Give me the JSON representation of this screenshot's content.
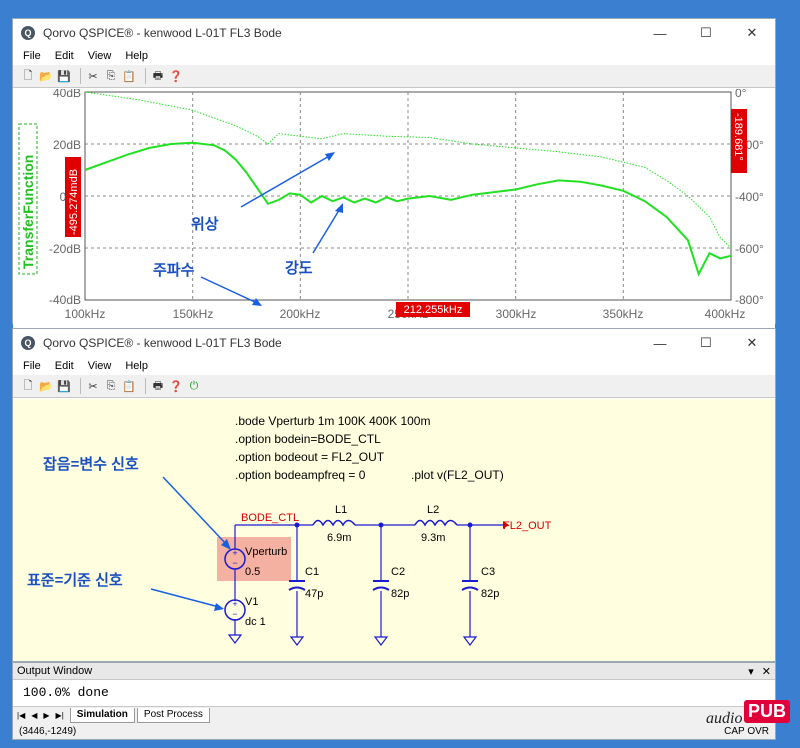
{
  "window1": {
    "title": "Qorvo QSPICE® - kenwood L-01T FL3 Bode",
    "menu": [
      "File",
      "Edit",
      "View",
      "Help"
    ]
  },
  "window2": {
    "title": "Qorvo QSPICE® - kenwood L-01T FL3 Bode",
    "menu": [
      "File",
      "Edit",
      "View",
      "Help"
    ]
  },
  "window_buttons": {
    "minimize": "—",
    "maximize": "☐",
    "close": "✕"
  },
  "bode": {
    "ylabel": "TransferFunction",
    "left_ticks": [
      "40dB",
      "20dB",
      "0dB",
      "-20dB",
      "-40dB"
    ],
    "right_ticks": [
      "0°",
      "-200°",
      "-400°",
      "-600°",
      "-800°"
    ],
    "x_ticks": [
      "100kHz",
      "150kHz",
      "200kHz",
      "250kHz",
      "300kHz",
      "350kHz",
      "400kHz"
    ],
    "cursor_db": "-495.274mdB",
    "cursor_deg": "-189.681°",
    "cursor_freq": "212.255kHz",
    "annotations": {
      "phase": "위상",
      "magnitude": "강도",
      "frequency": "주파수"
    },
    "trace_color": "#22e022"
  },
  "chart_data": {
    "type": "line",
    "xlim": [
      100,
      400
    ],
    "ylim_left": [
      -40,
      40
    ],
    "ylim_right": [
      -800,
      0
    ],
    "grid": true,
    "series": [
      {
        "axis": "left",
        "style": "solid",
        "x": [
          100,
          110,
          120,
          130,
          140,
          150,
          160,
          165,
          170,
          175,
          180,
          185,
          190,
          195,
          200,
          205,
          210,
          215,
          220,
          225,
          230,
          235,
          240,
          245,
          250,
          260,
          270,
          280,
          290,
          300,
          310,
          320,
          330,
          340,
          350,
          360,
          370,
          380,
          385,
          390,
          395,
          400
        ],
        "y": [
          10,
          13,
          16,
          18.5,
          20,
          20.5,
          19.5,
          17.5,
          14,
          9,
          3,
          -3,
          -1.5,
          1,
          0.5,
          -2.5,
          0,
          -2,
          -0.5,
          -2.5,
          -1,
          -2.5,
          -0.5,
          -2,
          -1,
          0,
          -1.5,
          0.5,
          1.5,
          2.5,
          4.5,
          6,
          5.5,
          4,
          2,
          -2,
          -8,
          -17,
          -30,
          -22,
          -24,
          -23
        ]
      },
      {
        "axis": "right",
        "style": "dotted",
        "x": [
          100,
          125,
          150,
          170,
          180,
          185,
          190,
          200,
          210,
          220,
          240,
          260,
          280,
          300,
          320,
          340,
          360,
          370,
          380,
          390,
          395,
          400
        ],
        "y": [
          0,
          -30,
          -70,
          -130,
          -170,
          -200,
          -160,
          -170,
          -180,
          -160,
          -170,
          -175,
          -200,
          -215,
          -230,
          -250,
          -290,
          -340,
          -400,
          -480,
          -560,
          -600
        ]
      }
    ]
  },
  "schematic": {
    "directives": [
      ".bode Vperturb 1m 100K 400K 100m",
      ".option bodein=BODE_CTL",
      ".option bodeout = FL2_OUT",
      ".option bodeampfreq = 0"
    ],
    "plot": ".plot v(FL2_OUT)",
    "net_in": "BODE_CTL",
    "net_out": "FL2_OUT",
    "vperturb_name": "Vperturb",
    "vperturb_value": "0.5",
    "v1_name": "V1",
    "v1_value": "dc 1",
    "l1_name": "L1",
    "l1_value": "6.9m",
    "l2_name": "L2",
    "l2_value": "9.3m",
    "c1_name": "C1",
    "c1_value": "47p",
    "c2_name": "C2",
    "c2_value": "82p",
    "c3_name": "C3",
    "c3_value": "82p",
    "annotation_noise": "잡음=변수 신호",
    "annotation_ref": "표준=기준 신호"
  },
  "output_window": {
    "title": "Output Window",
    "text": "100.0% done",
    "tabs": [
      "Simulation",
      "Post Process"
    ]
  },
  "status": {
    "coords": "(3446,-1249)",
    "indicators": "CAP OVR"
  },
  "logo": {
    "audio": "audio",
    "pub": "PUB"
  }
}
